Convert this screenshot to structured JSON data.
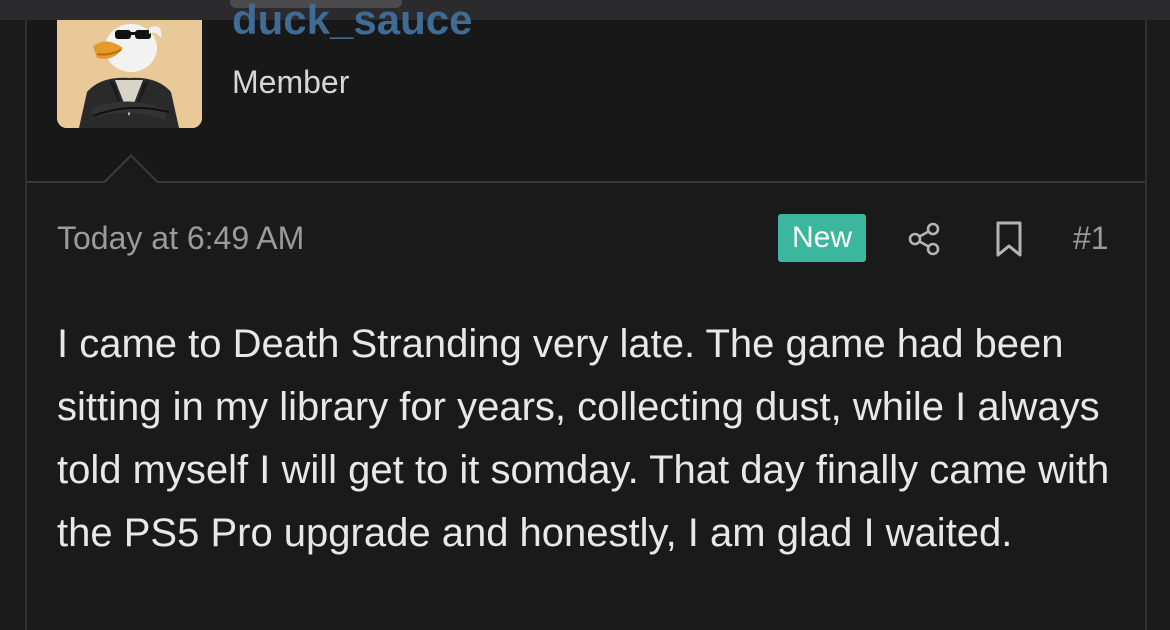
{
  "user": {
    "username": "duck_sauce",
    "title": "Member"
  },
  "post": {
    "timestamp": "Today at 6:49 AM",
    "badge": "New",
    "number": "#1",
    "body": "I came to Death Stranding very late. The game had been sitting in my library for years, collecting dust, while I always told myself I will get to it somday. That day finally came with the PS5 Pro upgrade and honestly, I am glad I waited."
  },
  "icons": {
    "share": "share-icon",
    "bookmark": "bookmark-icon",
    "avatar": "duck-avatar"
  },
  "colors": {
    "background": "#1b1b1c",
    "username": "#3f6b95",
    "badge": "#3ab79d",
    "muted_text": "#9b9b9b",
    "body_text": "#e8e8e8"
  }
}
